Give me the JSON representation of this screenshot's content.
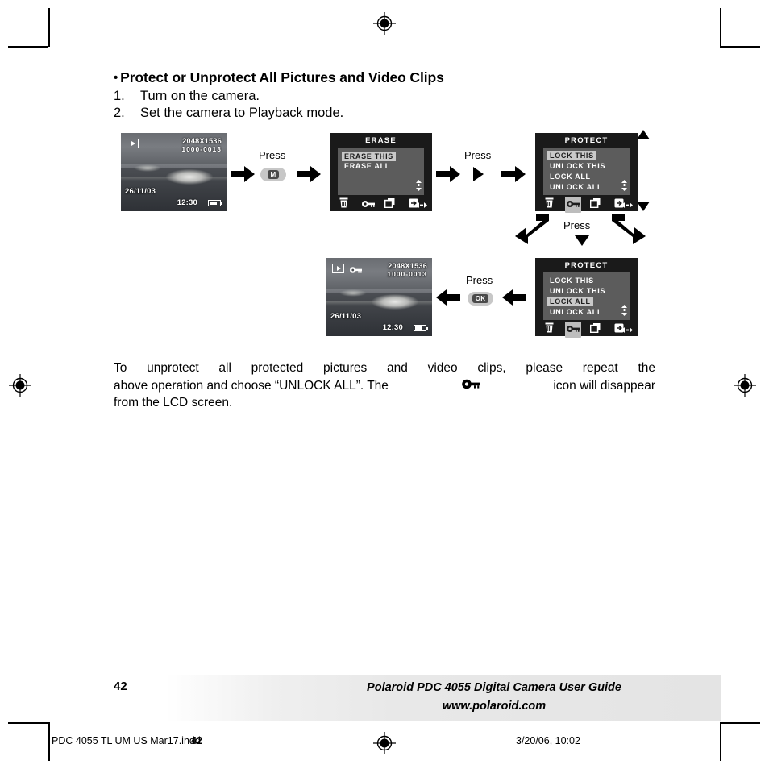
{
  "heading": {
    "bullet": "•",
    "text": "Protect or Unprotect All Pictures and Video Clips"
  },
  "steps": [
    {
      "num": "1.",
      "text": "Turn on the camera."
    },
    {
      "num": "2.",
      "text": "Set the camera to Playback mode."
    }
  ],
  "screens": {
    "photo_start": {
      "resolution": "2048X1536",
      "file_number": "1000-0013",
      "date": "26/11/03",
      "time": "12:30",
      "mode_icon": "playback-icon",
      "battery_icon": "battery-icon"
    },
    "erase_menu": {
      "title": "ERASE",
      "items": [
        {
          "label": "ERASE THIS",
          "selected": true
        },
        {
          "label": "ERASE ALL",
          "selected": false
        }
      ],
      "scroll_hint": "up-down-arrows",
      "toolbar": [
        {
          "icon": "trash-icon",
          "active": false
        },
        {
          "icon": "key-icon",
          "active": false
        },
        {
          "icon": "copy-icon",
          "active": false
        },
        {
          "icon": "exit-icon",
          "active": false
        },
        {
          "icon": "left-right-arrows-icon",
          "active": false
        }
      ]
    },
    "protect_menu_lock_this": {
      "title": "PROTECT",
      "items": [
        {
          "label": "LOCK THIS",
          "selected": true
        },
        {
          "label": "UNLOCK THIS",
          "selected": false
        },
        {
          "label": "LOCK ALL",
          "selected": false
        },
        {
          "label": "UNLOCK ALL",
          "selected": false
        }
      ],
      "scroll_hint": "up-down-arrows",
      "toolbar": [
        {
          "icon": "trash-icon",
          "active": false
        },
        {
          "icon": "key-icon",
          "active": true
        },
        {
          "icon": "copy-icon",
          "active": false
        },
        {
          "icon": "exit-icon",
          "active": false
        },
        {
          "icon": "left-right-arrows-icon",
          "active": false
        }
      ]
    },
    "protect_menu_lock_all": {
      "title": "PROTECT",
      "items": [
        {
          "label": "LOCK THIS",
          "selected": false
        },
        {
          "label": "UNLOCK THIS",
          "selected": false
        },
        {
          "label": "LOCK ALL",
          "selected": true
        },
        {
          "label": "UNLOCK ALL",
          "selected": false
        }
      ],
      "scroll_hint": "up-down-arrows",
      "toolbar": [
        {
          "icon": "trash-icon",
          "active": false
        },
        {
          "icon": "key-icon",
          "active": true
        },
        {
          "icon": "copy-icon",
          "active": false
        },
        {
          "icon": "exit-icon",
          "active": false
        },
        {
          "icon": "left-right-arrows-icon",
          "active": false
        }
      ]
    },
    "photo_protected": {
      "resolution": "2048X1536",
      "file_number": "1000-0013",
      "date": "26/11/03",
      "time": "12:30",
      "mode_icon": "playback-icon",
      "protect_icon": "key-icon",
      "battery_icon": "battery-icon"
    }
  },
  "flow_labels": {
    "press_m": "Press",
    "press_right": "Press",
    "press_down": "Press",
    "press_ok": "Press"
  },
  "buttons": {
    "mode_button": "M",
    "ok_button": "OK"
  },
  "paragraph": {
    "line1": "To unprotect all protected pictures and video clips, please repeat the",
    "line2a": "above operation and choose “UNLOCK ALL”. The",
    "line2b": "icon will disappear",
    "line3": "from the LCD screen.",
    "inline_icon": "key-icon"
  },
  "footer": {
    "page_number": "42",
    "title": "Polaroid PDC 4055 Digital Camera User Guide",
    "website": "www.polaroid.com"
  },
  "print_slug": {
    "filename": "PDC 4055 TL UM US Mar17.indd",
    "page": "42",
    "timestamp": "3/20/06, 10:02"
  },
  "colors": {
    "lcd_menu_bg": "#1a1a1a",
    "lcd_menu_box": "#5c5c5c",
    "highlight": "#c9c9c9",
    "button_pill": "#c7c7c7",
    "arrow": "#000000"
  }
}
